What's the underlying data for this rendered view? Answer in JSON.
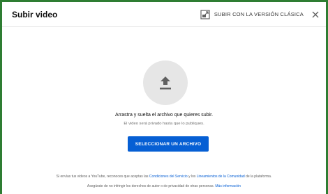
{
  "dialog": {
    "title": "Subir video",
    "classic_label": "SUBIR CON LA VERSIÓN CLÁSICA",
    "close_icon": "close-icon",
    "classic_icon": "classic-upload-icon"
  },
  "upload": {
    "icon": "upload-arrow-icon",
    "main_text": "Arrastra y suelta el archivo que quieres subir.",
    "sub_text": "El video será privado hasta que lo publiques.",
    "button_label": "SELECCIONAR UN ARCHIVO"
  },
  "footer": {
    "line1_prefix": "Si envías tus videos a YouTube, reconoces que aceptas las ",
    "terms_link": "Condiciones del Servicio",
    "line1_middle": " y los ",
    "guidelines_link": "Lineamientos de la Comunidad",
    "line1_suffix": " de la plataforma.",
    "line2_prefix": "Asegúrate de no infringir los derechos de autor o de privacidad de otras personas. ",
    "more_info_link": "Más información"
  },
  "colors": {
    "accent": "#065fd4",
    "window_border": "#2e7d32",
    "circle_bg": "#e6e6e6",
    "icon_gray": "#606060"
  }
}
